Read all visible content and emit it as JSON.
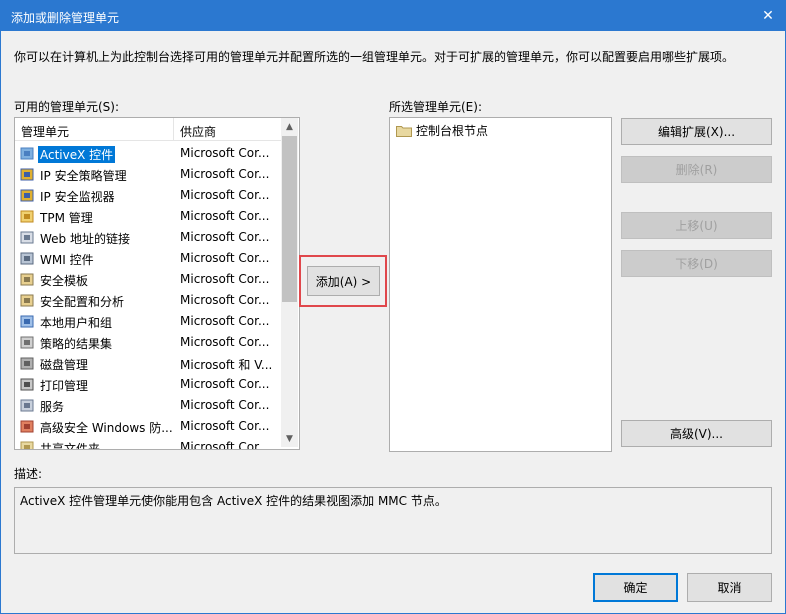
{
  "dialog": {
    "title": "添加或删除管理单元",
    "close_glyph": "✕",
    "intro": "你可以在计算机上为此控制台选择可用的管理单元并配置所选的一组管理单元。对于可扩展的管理单元，你可以配置要启用哪些扩展项。"
  },
  "available": {
    "label": "可用的管理单元(S):",
    "col_name": "管理单元",
    "col_vendor": "供应商",
    "items": [
      {
        "name": "ActiveX 控件",
        "vendor": "Microsoft Cor...",
        "icon": "activex-icon"
      },
      {
        "name": "IP 安全策略管理",
        "vendor": "Microsoft Cor...",
        "icon": "ip-security-policy-icon"
      },
      {
        "name": "IP 安全监视器",
        "vendor": "Microsoft Cor...",
        "icon": "ip-security-monitor-icon"
      },
      {
        "name": "TPM 管理",
        "vendor": "Microsoft Cor...",
        "icon": "tpm-icon"
      },
      {
        "name": "Web 地址的链接",
        "vendor": "Microsoft Cor...",
        "icon": "web-link-icon"
      },
      {
        "name": "WMI 控件",
        "vendor": "Microsoft Cor...",
        "icon": "wmi-icon"
      },
      {
        "name": "安全模板",
        "vendor": "Microsoft Cor...",
        "icon": "security-template-icon"
      },
      {
        "name": "安全配置和分析",
        "vendor": "Microsoft Cor...",
        "icon": "security-config-icon"
      },
      {
        "name": "本地用户和组",
        "vendor": "Microsoft Cor...",
        "icon": "users-groups-icon"
      },
      {
        "name": "策略的结果集",
        "vendor": "Microsoft Cor...",
        "icon": "rsop-icon"
      },
      {
        "name": "磁盘管理",
        "vendor": "Microsoft 和 V...",
        "icon": "disk-management-icon"
      },
      {
        "name": "打印管理",
        "vendor": "Microsoft Cor...",
        "icon": "print-management-icon"
      },
      {
        "name": "服务",
        "vendor": "Microsoft Cor...",
        "icon": "services-gear-icon"
      },
      {
        "name": "高级安全 Windows 防...",
        "vendor": "Microsoft Cor...",
        "icon": "firewall-icon"
      },
      {
        "name": "共享文件夹",
        "vendor": "Microsoft Cor...",
        "icon": "shared-folder-icon"
      }
    ]
  },
  "add_button": "添加(A) >",
  "selected": {
    "label": "所选管理单元(E):",
    "items": [
      {
        "name": "控制台根节点",
        "icon": "folder-icon"
      }
    ]
  },
  "side_buttons": {
    "edit_extensions": "编辑扩展(X)...",
    "remove": "删除(R)",
    "move_up": "上移(U)",
    "move_down": "下移(D)",
    "advanced": "高级(V)..."
  },
  "description": {
    "label": "描述:",
    "text": "ActiveX 控件管理单元使你能用包含 ActiveX 控件的结果视图添加 MMC 节点。"
  },
  "footer": {
    "ok": "确定",
    "cancel": "取消"
  }
}
